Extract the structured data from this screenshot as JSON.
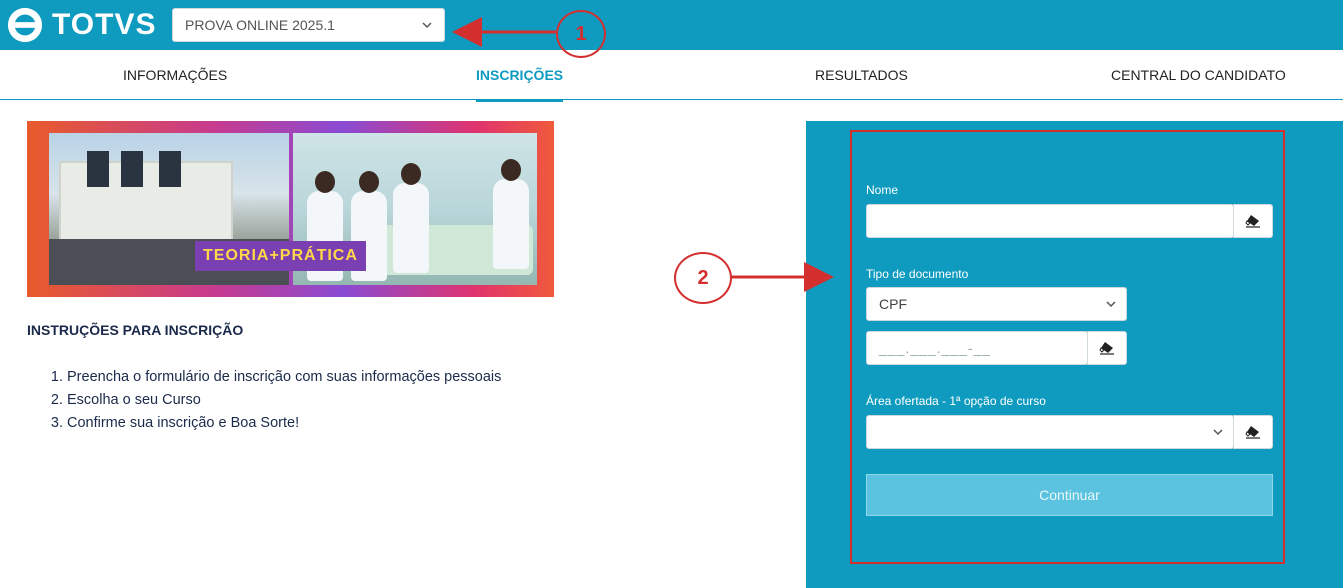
{
  "brand": {
    "name": "TOTVS"
  },
  "header": {
    "period_selected": "PROVA ONLINE 2025.1"
  },
  "nav": {
    "tabs": [
      {
        "label": "INFORMAÇÕES"
      },
      {
        "label": "INSCRIÇÕES",
        "active": true
      },
      {
        "label": "RESULTADOS"
      },
      {
        "label": "CENTRAL DO CANDIDATO"
      }
    ]
  },
  "banner": {
    "tag": "TEORIA+PRÁTICA"
  },
  "instructions": {
    "title": "INSTRUÇÕES PARA INSCRIÇÃO",
    "items": [
      "Preencha o formulário de inscrição com suas informações pessoais",
      "Escolha o seu Curso",
      "Confirme sua inscrição e Boa Sorte!"
    ]
  },
  "form": {
    "name_label": "Nome",
    "name_value": "",
    "doc_type_label": "Tipo de documento",
    "doc_type_selected": "CPF",
    "doc_mask": "___.___.___-__",
    "area_label": "Área ofertada - 1ª opção de curso",
    "area_selected": "",
    "continue_label": "Continuar"
  },
  "annotations": {
    "marker1": "1",
    "marker2": "2"
  },
  "icons": {
    "clear": "eraser-icon",
    "dropdown": "chevron-down-icon"
  },
  "colors": {
    "primary": "#0f9bbf",
    "annotation": "#d32f2f",
    "button": "#5bc3e0"
  }
}
